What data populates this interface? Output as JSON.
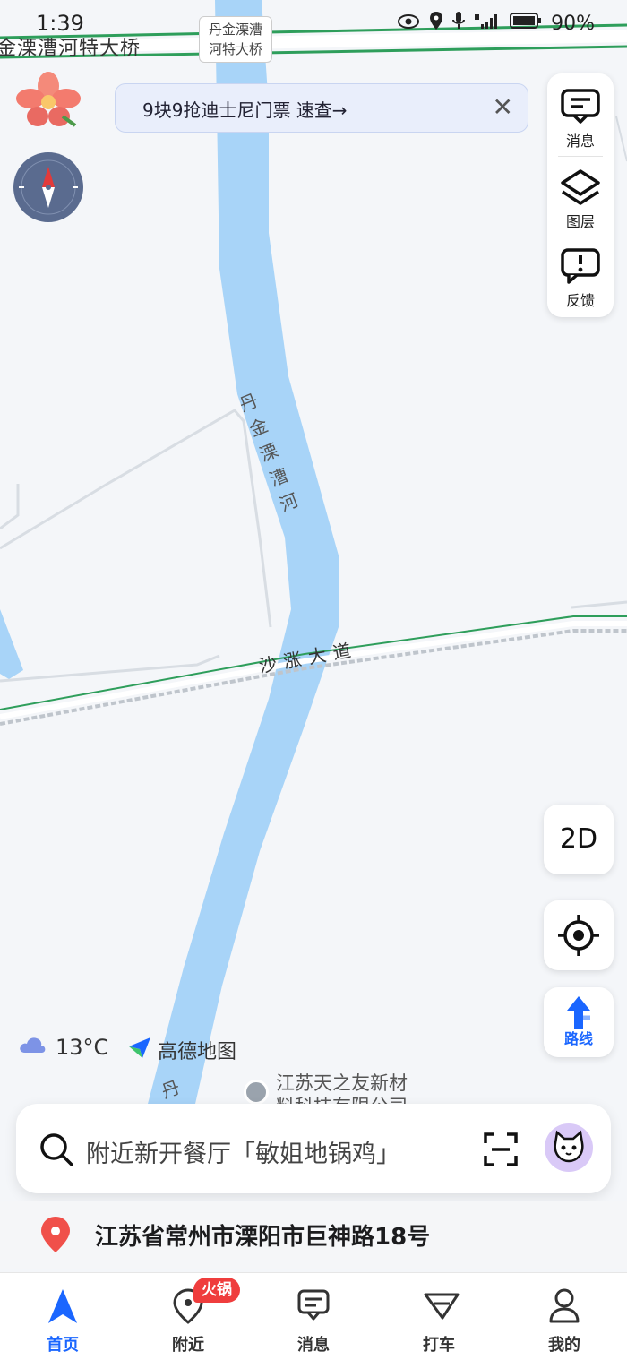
{
  "status_bar": {
    "time": "1:39",
    "battery": "90%"
  },
  "map": {
    "top_road_name": "金溧漕河特大桥",
    "bridge_tag": [
      "丹金溧漕",
      "河特大桥"
    ],
    "river_name": "丹金溧漕河",
    "road_name": "沙涨大道",
    "river_name_partial": "丹",
    "poi_name": [
      "江苏天之友新材",
      "料科技有限公司"
    ]
  },
  "promo": {
    "text": "9块9抢迪士尼门票 速查→",
    "close_icon": "close-icon"
  },
  "right_panel": [
    {
      "label": "消息",
      "icon": "message-icon"
    },
    {
      "label": "图层",
      "icon": "layers-icon"
    },
    {
      "label": "反馈",
      "icon": "feedback-icon"
    }
  ],
  "controls": {
    "view_mode": "2D",
    "route_label": "路线"
  },
  "weather": {
    "temp": "13°C",
    "icon": "cloud-icon"
  },
  "brand": {
    "name": "高德地图"
  },
  "search": {
    "placeholder": "附近新开餐厅「敏姐地锅鸡」"
  },
  "address": {
    "text": "江苏省常州市溧阳市巨神路18号"
  },
  "tabs": [
    {
      "label": "首页",
      "icon": "home-arrow-icon",
      "active": true
    },
    {
      "label": "附近",
      "icon": "location-pin-icon",
      "badge": "火锅"
    },
    {
      "label": "消息",
      "icon": "message-icon"
    },
    {
      "label": "打车",
      "icon": "taxi-icon"
    },
    {
      "label": "我的",
      "icon": "user-icon"
    }
  ],
  "colors": {
    "accent": "#1a66ff",
    "river": "#a8d4f8",
    "road_green": "#2e9e5b",
    "badge_red": "#ef3d3d"
  }
}
